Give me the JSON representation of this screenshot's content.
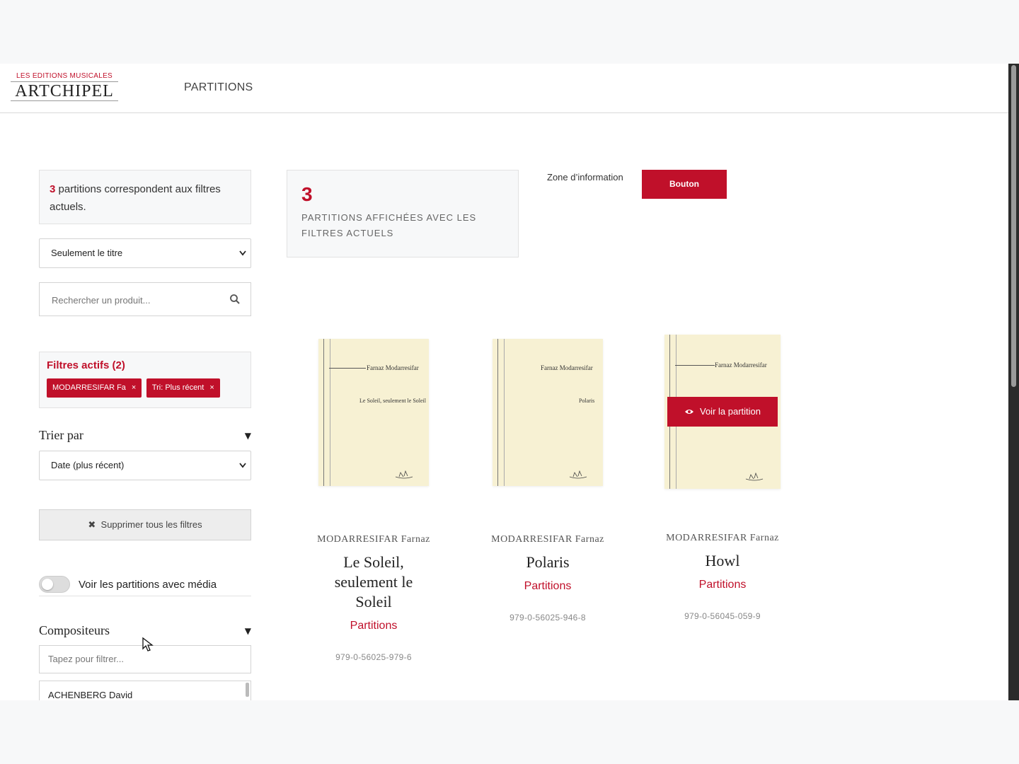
{
  "header": {
    "logo_top": "LES EDITIONS MUSICALES",
    "logo_main": "ARTCHIPEL",
    "nav_partitions": "PARTITIONS"
  },
  "sidebar": {
    "result_count": "3",
    "result_text": " partitions correspondent aux filtres actuels.",
    "search_scope": "Seulement le titre",
    "search_placeholder": "Rechercher un produit...",
    "active_filters_title": "Filtres actifs (2)",
    "chips": [
      {
        "label": "MODARRESIFAR Fa",
        "remove": "×"
      },
      {
        "label": "Tri: Plus récent",
        "remove": "×"
      }
    ],
    "sort_title": "Trier par",
    "sort_value": "Date (plus récent)",
    "clear_label": "Supprimer tous les filtres",
    "media_toggle_label": "Voir les partitions avec média",
    "media_toggle_on": false,
    "composers_title": "Compositeurs",
    "composer_filter_placeholder": "Tapez pour filtrer...",
    "composers": [
      "ACHENBERG David"
    ]
  },
  "stats": {
    "count": "3",
    "label": "PARTITIONS AFFICHÉES AVEC LES FILTRES ACTUELS"
  },
  "info": {
    "zone_label": "Zone d’information",
    "button_label": "Bouton"
  },
  "products": [
    {
      "cover_author": "Farnaz Modarresifar",
      "cover_title": "Le Soleil, seulement le Soleil",
      "composer": "MODARRESIFAR Farnaz",
      "title": "Le Soleil, seulement le Soleil",
      "category": "Partitions",
      "isbn": "979-0-56025-979-6"
    },
    {
      "cover_author": "Farnaz Modarresifar",
      "cover_title": "Polaris",
      "composer": "MODARRESIFAR Farnaz",
      "title": "Polaris",
      "category": "Partitions",
      "isbn": "979-0-56025-946-8"
    },
    {
      "cover_author": "Farnaz Modarresifar",
      "cover_title": "",
      "composer": "MODARRESIFAR Farnaz",
      "title": "Howl",
      "category": "Partitions",
      "isbn": "979-0-56045-059-9",
      "hover_button": "Voir la partition"
    }
  ],
  "colors": {
    "accent": "#c0102a",
    "cover": "#f7f1d3"
  },
  "icons": [
    "search-icon",
    "chevron-down-icon",
    "close-icon",
    "eye-icon",
    "triangle-down-icon",
    "cursor-icon"
  ]
}
